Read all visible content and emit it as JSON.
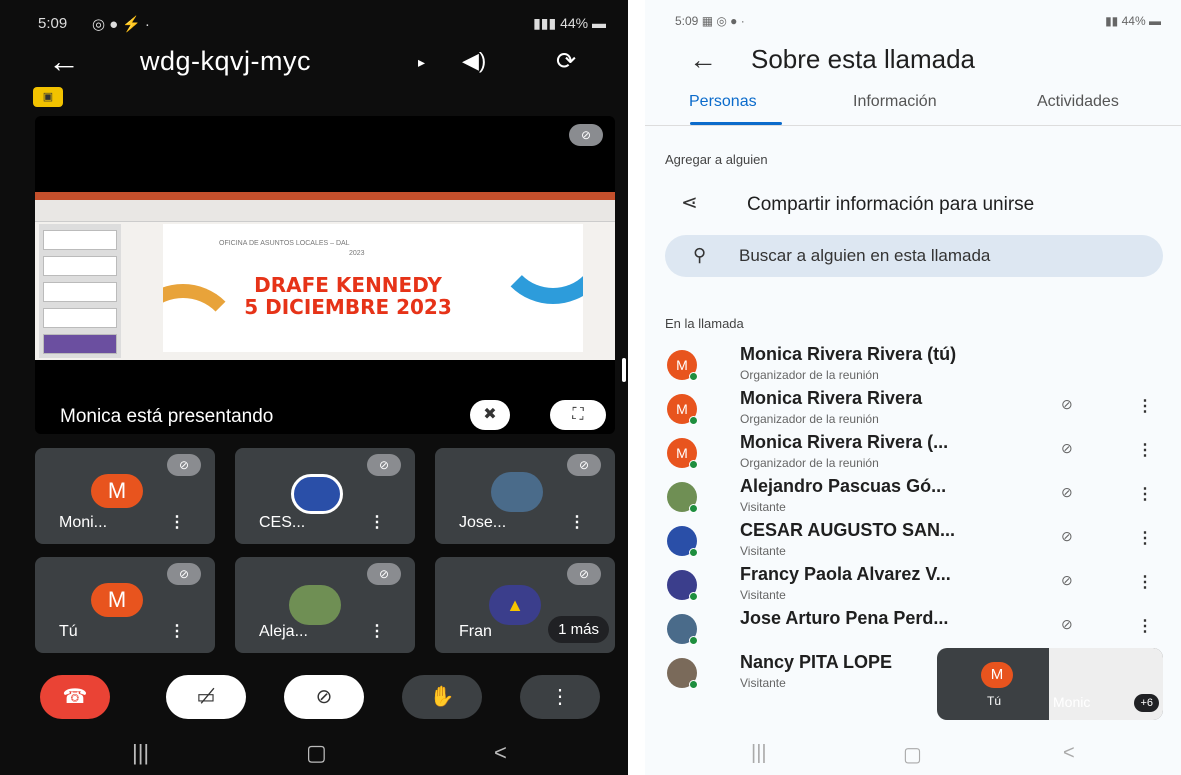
{
  "left": {
    "status_time": "5:09",
    "status_right": "44%",
    "meeting_code": "wdg-kqvj-myc",
    "slide": {
      "office_text": "OFICINA DE ASUNTOS LOCALES – DAL",
      "year_small": "2023",
      "line1": "DRAFE KENNEDY",
      "line2": "5 DICIEMBRE 2023"
    },
    "presenting_label": "Monica está presentando",
    "tiles": [
      {
        "name": "Moni...",
        "avatar": "M"
      },
      {
        "name": "CES..."
      },
      {
        "name": "Jose..."
      },
      {
        "name": "Tú",
        "avatar": "M"
      },
      {
        "name": "Aleja..."
      },
      {
        "name": "Fran",
        "extra": "1 más"
      }
    ],
    "colors": {
      "end_call": "#ea4335",
      "avatar": "#e8541e",
      "tile_bg": "#3c4043"
    }
  },
  "right": {
    "status_time": "5:09",
    "status_right": "44%",
    "title": "Sobre esta llamada",
    "tabs": [
      "Personas",
      "Información",
      "Actividades"
    ],
    "active_tab": "Personas",
    "add_section": "Agregar a alguien",
    "share_label": "Compartir información para unirse",
    "search_placeholder": "Buscar a alguien en esta llamada",
    "in_call_section": "En la llamada",
    "people": [
      {
        "name": "Monica Rivera Rivera (tú)",
        "role": "Organizador de la reunión",
        "avatar": "M",
        "avatar_color": "#e8541e",
        "muted": false
      },
      {
        "name": "Monica Rivera Rivera",
        "role": "Organizador de la reunión",
        "avatar": "M",
        "avatar_color": "#e8541e",
        "muted": true
      },
      {
        "name": "Monica Rivera Rivera (...",
        "role": "Organizador de la reunión",
        "avatar": "M",
        "avatar_color": "#e8541e",
        "muted": true
      },
      {
        "name": "Alejandro Pascuas Gó...",
        "role": "Visitante",
        "avatar": "",
        "avatar_color": "#6f8f54",
        "muted": true
      },
      {
        "name": "CESAR AUGUSTO SAN...",
        "role": "Visitante",
        "avatar": "",
        "avatar_color": "#2a4fa8",
        "muted": true
      },
      {
        "name": "Francy Paola Alvarez V...",
        "role": "Visitante",
        "avatar": "",
        "avatar_color": "#3b3e8c",
        "muted": true
      },
      {
        "name": "Jose Arturo Pena Perd...",
        "role": "",
        "avatar": "",
        "avatar_color": "#4a6b8a",
        "muted": true
      },
      {
        "name": "Nancy PITA LOPE",
        "role": "Visitante",
        "avatar": "",
        "avatar_color": "#7a6a5a",
        "muted": false
      }
    ],
    "pip": {
      "self_label": "Tú",
      "avatar": "M",
      "other_label": "Monic",
      "count": "+6"
    }
  }
}
